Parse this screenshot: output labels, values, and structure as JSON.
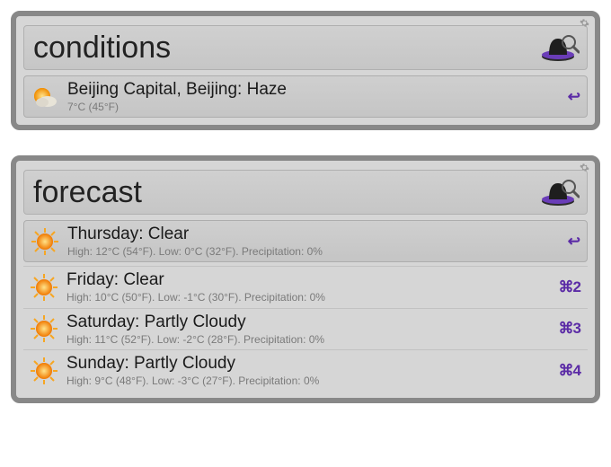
{
  "panels": [
    {
      "query": "conditions",
      "results": [
        {
          "title": "Beijing Capital, Beijing: Haze",
          "subtitle": "7°C (45°F)",
          "shortcut": "↩",
          "selected": true,
          "icon": "cloudy"
        }
      ]
    },
    {
      "query": "forecast",
      "results": [
        {
          "title": "Thursday: Clear",
          "subtitle": "High: 12°C (54°F). Low: 0°C (32°F). Precipitation: 0%",
          "shortcut": "↩",
          "selected": true,
          "icon": "sun"
        },
        {
          "title": "Friday: Clear",
          "subtitle": "High: 10°C (50°F). Low: -1°C (30°F). Precipitation: 0%",
          "shortcut": "⌘2",
          "selected": false,
          "icon": "sun"
        },
        {
          "title": "Saturday: Partly Cloudy",
          "subtitle": "High: 11°C (52°F). Low: -2°C (28°F). Precipitation: 0%",
          "shortcut": "⌘3",
          "selected": false,
          "icon": "sun"
        },
        {
          "title": "Sunday: Partly Cloudy",
          "subtitle": "High: 9°C (48°F). Low: -3°C (27°F). Precipitation: 0%",
          "shortcut": "⌘4",
          "selected": false,
          "icon": "sun"
        }
      ]
    }
  ]
}
